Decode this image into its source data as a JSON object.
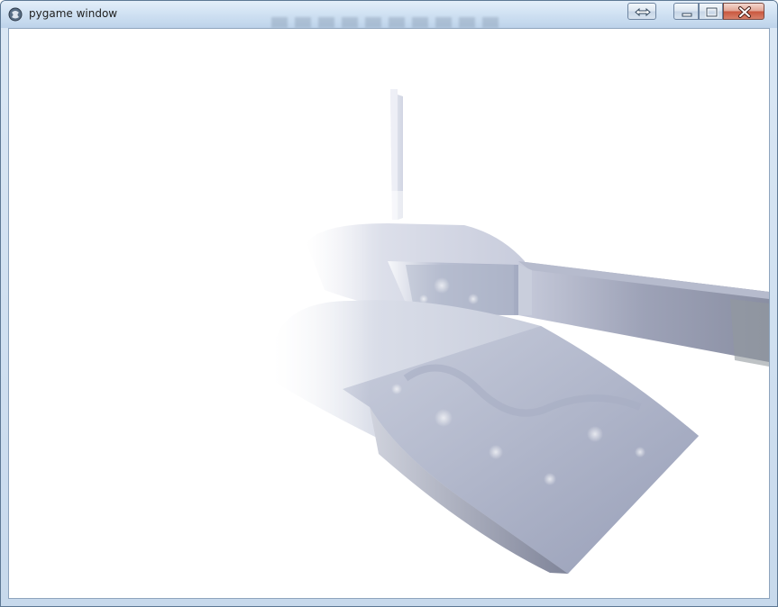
{
  "window": {
    "title": "pygame window",
    "app_icon": "pygame-snake-icon",
    "controls": {
      "swap_icon": "swap-arrows-icon",
      "minimize_icon": "minimize-icon",
      "maximize_icon": "maximize-icon",
      "close_icon": "close-icon"
    }
  },
  "scene": {
    "description_colors": {
      "fog": "#ffffff",
      "rock_light": "#d3d8e6",
      "rock_mid": "#a9b0c8",
      "rock_dark": "#8f97b0",
      "shadow_face": "#7d839a"
    }
  }
}
